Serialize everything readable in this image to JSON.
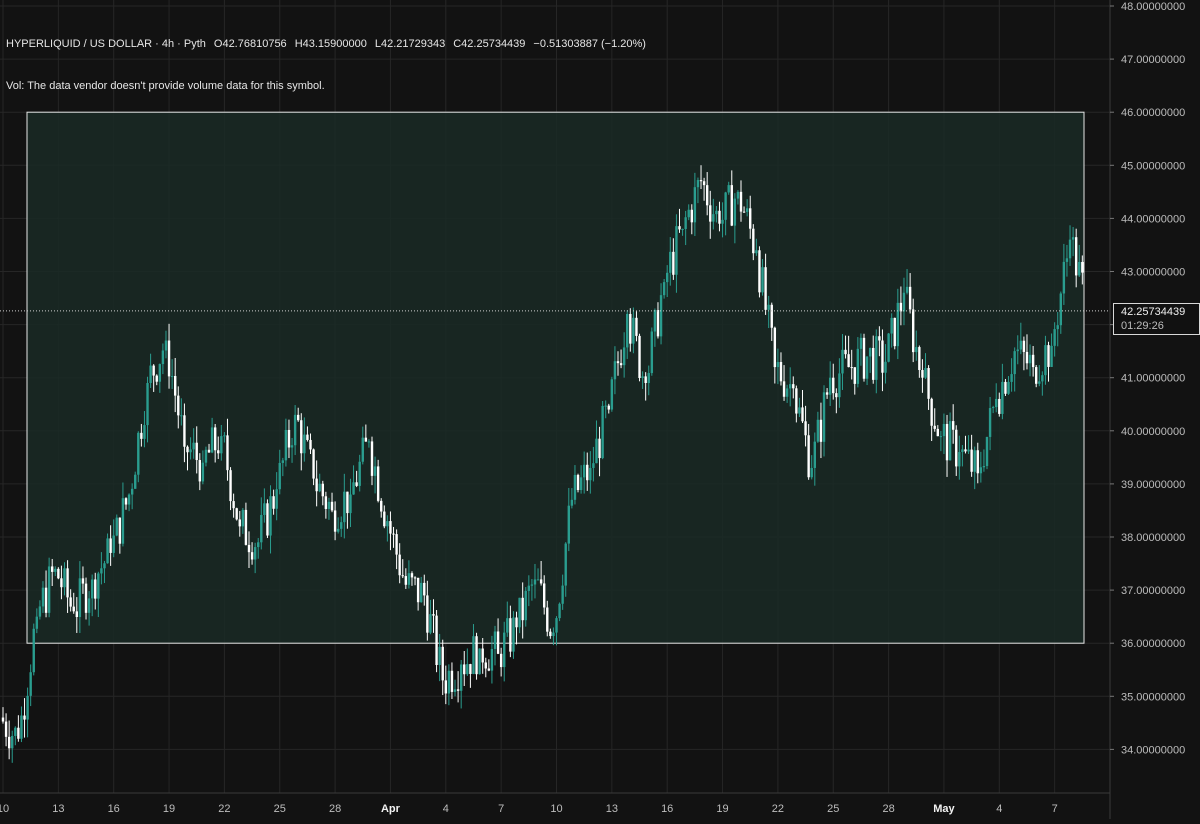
{
  "header": {
    "symbol": "HYPERLIQUID / US DOLLAR · 4h · Pyth",
    "open": "O42.76810756",
    "high": "H43.15900000",
    "low": "L42.21729343",
    "close": "C42.25734439",
    "change": "−0.51303887 (−1.20%)",
    "vol_note": "Vol: The data vendor doesn't provide volume data for this symbol."
  },
  "price_label": {
    "price": "42.25734439",
    "countdown": "01:29:26"
  },
  "colors": {
    "background": "#121212",
    "up": "#2a9d8f",
    "down": "#ffffff",
    "grid": "#262626",
    "box_fill": "#1a2a26",
    "box_stroke": "#e6e6e6"
  },
  "chart_data": {
    "type": "candlestick",
    "interval": "4h",
    "y_axis": {
      "ylim": [
        33.3,
        48.0
      ],
      "ticks": [
        34,
        35,
        36,
        37,
        38,
        39,
        40,
        41,
        42,
        43,
        44,
        45,
        46,
        47,
        48
      ],
      "tick_labels": [
        "34.00000000",
        "35.00000000",
        "36.00000000",
        "37.00000000",
        "38.00000000",
        "39.00000000",
        "40.00000000",
        "41.00000000",
        "42.00000000",
        "43.00000000",
        "44.00000000",
        "45.00000000",
        "46.00000000",
        "47.00000000",
        "48.00000000"
      ]
    },
    "x_axis": {
      "tick_labels": [
        "10",
        "13",
        "16",
        "19",
        "22",
        "25",
        "28",
        "Apr",
        "4",
        "7",
        "10",
        "13",
        "16",
        "19",
        "22",
        "25",
        "28",
        "May",
        "4",
        "7"
      ],
      "bold_labels": [
        "Apr",
        "May"
      ]
    },
    "last_price": 42.25734439,
    "range_box": {
      "top": 46.0,
      "bottom": 36.0,
      "start": "Mar 10",
      "end": "May 7"
    },
    "daily_closes": [
      {
        "date": "Mar 10",
        "close": 34.2
      },
      {
        "date": "Mar 11",
        "close": 36.5
      },
      {
        "date": "Mar 12",
        "close": 37.4
      },
      {
        "date": "Mar 13",
        "close": 36.6
      },
      {
        "date": "Mar 14",
        "close": 37.2
      },
      {
        "date": "Mar 15",
        "close": 37.7
      },
      {
        "date": "Mar 16",
        "close": 38.8
      },
      {
        "date": "Mar 17",
        "close": 40.9
      },
      {
        "date": "Mar 18",
        "close": 41.7
      },
      {
        "date": "Mar 19",
        "close": 39.7
      },
      {
        "date": "Mar 20",
        "close": 39.4
      },
      {
        "date": "Mar 21",
        "close": 39.9
      },
      {
        "date": "Mar 22",
        "close": 38.2
      },
      {
        "date": "Mar 23",
        "close": 37.9
      },
      {
        "date": "Mar 24",
        "close": 38.9
      },
      {
        "date": "Mar 25",
        "close": 40.3
      },
      {
        "date": "Mar 26",
        "close": 39.1
      },
      {
        "date": "Mar 27",
        "close": 38.5
      },
      {
        "date": "Mar 28",
        "close": 38.8
      },
      {
        "date": "Mar 29",
        "close": 39.8
      },
      {
        "date": "Mar 30",
        "close": 38.3
      },
      {
        "date": "Mar 31",
        "close": 37.1
      },
      {
        "date": "Apr 1",
        "close": 36.9
      },
      {
        "date": "Apr 2",
        "close": 35.3
      },
      {
        "date": "Apr 3",
        "close": 35.6
      },
      {
        "date": "Apr 4",
        "close": 35.9
      },
      {
        "date": "Apr 5",
        "close": 35.8
      },
      {
        "date": "Apr 6",
        "close": 36.3
      },
      {
        "date": "Apr 7",
        "close": 37.2
      },
      {
        "date": "Apr 8",
        "close": 36.2
      },
      {
        "date": "Apr 9",
        "close": 38.7
      },
      {
        "date": "Apr 10",
        "close": 39.3
      },
      {
        "date": "Apr 11",
        "close": 40.4
      },
      {
        "date": "Apr 12",
        "close": 42.2
      },
      {
        "date": "Apr 13",
        "close": 40.9
      },
      {
        "date": "Apr 14",
        "close": 42.8
      },
      {
        "date": "Apr 15",
        "close": 43.8
      },
      {
        "date": "Apr 16",
        "close": 44.7
      },
      {
        "date": "Apr 17",
        "close": 43.9
      },
      {
        "date": "Apr 18",
        "close": 44.5
      },
      {
        "date": "Apr 19",
        "close": 43.4
      },
      {
        "date": "Apr 20",
        "close": 41.2
      },
      {
        "date": "Apr 21",
        "close": 40.8
      },
      {
        "date": "Apr 22",
        "close": 39.3
      },
      {
        "date": "Apr 23",
        "close": 41.0
      },
      {
        "date": "Apr 24",
        "close": 41.2
      },
      {
        "date": "Apr 25",
        "close": 41.4
      },
      {
        "date": "Apr 26",
        "close": 41.3
      },
      {
        "date": "Apr 27",
        "close": 42.6
      },
      {
        "date": "Apr 28",
        "close": 41.0
      },
      {
        "date": "Apr 29",
        "close": 39.9
      },
      {
        "date": "Apr 30",
        "close": 39.6
      },
      {
        "date": "May 1",
        "close": 39.2
      },
      {
        "date": "May 2",
        "close": 40.6
      },
      {
        "date": "May 3",
        "close": 41.5
      },
      {
        "date": "May 4",
        "close": 41.2
      },
      {
        "date": "May 5",
        "close": 41.6
      },
      {
        "date": "May 6",
        "close": 43.6
      },
      {
        "date": "May 7",
        "close": 42.26
      }
    ]
  }
}
